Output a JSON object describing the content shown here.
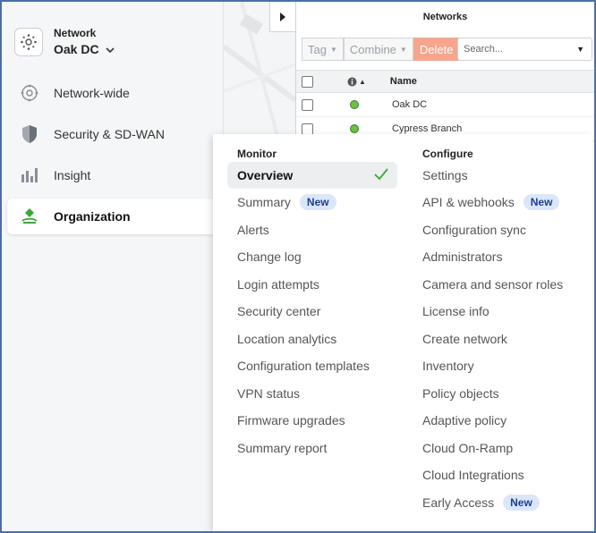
{
  "sidebar": {
    "network_label": "Network",
    "network_name": "Oak DC",
    "items": [
      {
        "label": "Network-wide",
        "icon": "network-wide-icon"
      },
      {
        "label": "Security & SD-WAN",
        "icon": "shield-icon"
      },
      {
        "label": "Insight",
        "icon": "bar-chart-icon"
      },
      {
        "label": "Organization",
        "icon": "organization-icon",
        "active": true
      }
    ]
  },
  "networks_panel": {
    "title": "Networks",
    "toolbar": {
      "tag": "Tag",
      "combine": "Combine",
      "delete": "Delete"
    },
    "search_placeholder": "Search...",
    "columns": {
      "name": "Name"
    },
    "rows": [
      {
        "name": "Oak DC",
        "status": "online"
      },
      {
        "name": "Cypress Branch",
        "status": "online"
      }
    ]
  },
  "menu": {
    "monitor": {
      "heading": "Monitor",
      "items": [
        {
          "label": "Overview",
          "selected": true
        },
        {
          "label": "Summary",
          "badge": "New"
        },
        {
          "label": "Alerts"
        },
        {
          "label": "Change log"
        },
        {
          "label": "Login attempts"
        },
        {
          "label": "Security center"
        },
        {
          "label": "Location analytics"
        },
        {
          "label": "Configuration templates"
        },
        {
          "label": "VPN status"
        },
        {
          "label": "Firmware upgrades"
        },
        {
          "label": "Summary report"
        }
      ]
    },
    "configure": {
      "heading": "Configure",
      "items": [
        {
          "label": "Settings"
        },
        {
          "label": "API & webhooks",
          "badge": "New"
        },
        {
          "label": "Configuration sync"
        },
        {
          "label": "Administrators"
        },
        {
          "label": "Camera and sensor roles"
        },
        {
          "label": "License info"
        },
        {
          "label": "Create network"
        },
        {
          "label": "Inventory"
        },
        {
          "label": "Policy objects"
        },
        {
          "label": "Adaptive policy"
        },
        {
          "label": "Cloud On-Ramp"
        },
        {
          "label": "Cloud Integrations"
        },
        {
          "label": "Early Access",
          "badge": "New"
        }
      ]
    }
  },
  "colors": {
    "accent_green": "#6cc04a",
    "badge_bg": "#dbe6fb",
    "delete_bg": "#f7a58c"
  }
}
